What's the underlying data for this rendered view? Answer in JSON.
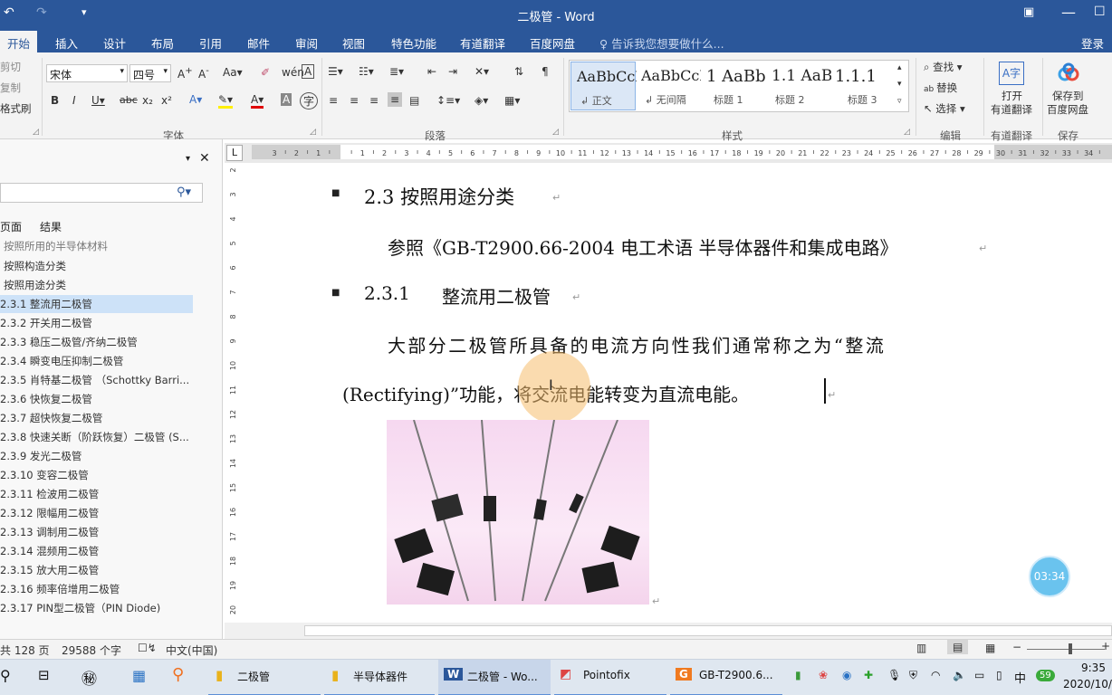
{
  "window": {
    "title": "二极管 - Word",
    "login": "登录"
  },
  "tabs": [
    "开始",
    "插入",
    "设计",
    "布局",
    "引用",
    "邮件",
    "审阅",
    "视图",
    "特色功能",
    "有道翻译",
    "百度网盘"
  ],
  "tell_me": "告诉我您想要做什么...",
  "clipboard": {
    "cut": "剪切",
    "copy": "复制",
    "format_painter": "格式刷"
  },
  "font": {
    "name": "宋体",
    "size": "四号",
    "group": "字体"
  },
  "paragraph": {
    "group": "段落"
  },
  "styles": {
    "group": "样式",
    "items": [
      {
        "preview": "AaBbCcDd",
        "name": "↲ 正文"
      },
      {
        "preview": "AaBbCcDd",
        "name": "↲ 无间隔"
      },
      {
        "preview": "1 AaBb",
        "name": "标题 1"
      },
      {
        "preview": "1.1 AaB",
        "name": "标题 2"
      },
      {
        "preview": "1.1.1",
        "name": "标题 3"
      }
    ]
  },
  "editing": {
    "find": "查找",
    "replace": "替换",
    "select": "选择",
    "group": "编辑"
  },
  "youdao": {
    "label1": "打开",
    "label2": "有道翻译",
    "group": "有道翻译"
  },
  "baidu": {
    "label1": "保存到",
    "label2": "百度网盘",
    "group": "保存"
  },
  "nav_pane": {
    "tabs": [
      "页面",
      "结果"
    ],
    "items": [
      "按照所用的半导体材料",
      "按照构造分类",
      "按照用途分类",
      "2.3.1 整流用二极管",
      "2.3.2 开关用二极管",
      "2.3.3 稳压二极管/齐纳二极管",
      "2.3.4 瞬变电压抑制二极管",
      "2.3.5 肖特基二极管 （Schottky Barri...",
      "2.3.6 快恢复二极管",
      "2.3.7 超快恢复二极管",
      "2.3.8 快速关断（阶跃恢复）二极管 (S...",
      "2.3.9 发光二极管",
      "2.3.10 变容二极管",
      "2.3.11 检波用二极管",
      "2.3.12 限幅用二极管",
      "2.3.13 调制用二极管",
      "2.3.14 混频用二极管",
      "2.3.15 放大用二极管",
      "2.3.16 频率倍增用二极管",
      "2.3.17 PIN型二极管（PIN Diode)"
    ]
  },
  "document": {
    "heading1": "2.3 按照用途分类",
    "para1": "参照《GB-T2900.66-2004 电工术语 半导体器件和集成电路》",
    "heading2_num": "2.3.1",
    "heading2_text": "整流用二极管",
    "para2_line1": "大部分二极管所具备的电流方向性我们通常称之为“整流",
    "para2_line2": "(Rectifying)”功能，将交流电能转变为直流电能。"
  },
  "timer": "03:34",
  "status": {
    "pages": "共 128 页",
    "words": "29588 个字",
    "lang": "中文(中国)"
  },
  "taskbar": {
    "items": [
      "二极管",
      "半导体器件",
      "二极管 - Wo...",
      "Pointofix",
      "GB-T2900.6..."
    ],
    "time": "9:35",
    "date": "2020/10/",
    "ime": "中",
    "badge": "59"
  },
  "colors": {
    "word_blue": "#2b579a",
    "nav_selected": "#cde2f8",
    "timer_bubble": "#6ac3ee"
  }
}
